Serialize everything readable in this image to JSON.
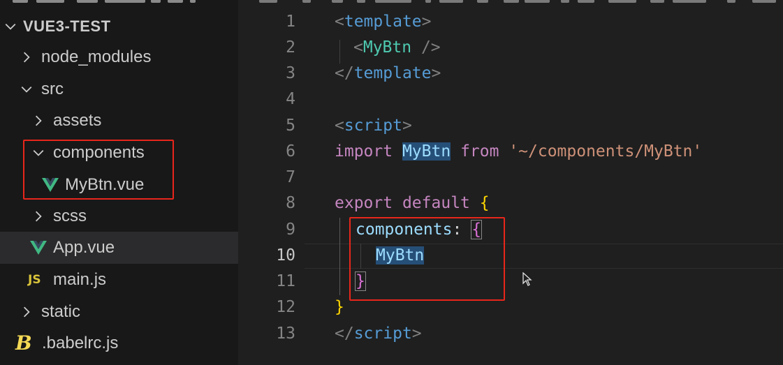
{
  "explorer": {
    "project": "VUE3-TEST",
    "items": [
      {
        "label": "node_modules",
        "kind": "folder",
        "expanded": false
      },
      {
        "label": "src",
        "kind": "folder",
        "expanded": true
      },
      {
        "label": "assets",
        "kind": "folder",
        "expanded": false
      },
      {
        "label": "components",
        "kind": "folder",
        "expanded": true
      },
      {
        "label": "MyBtn.vue",
        "kind": "vue-file"
      },
      {
        "label": "scss",
        "kind": "folder",
        "expanded": false
      },
      {
        "label": "App.vue",
        "kind": "vue-file",
        "selected": true
      },
      {
        "label": "main.js",
        "kind": "js-file",
        "icon_text": "JS"
      },
      {
        "label": "static",
        "kind": "folder",
        "expanded": false
      },
      {
        "label": ".babelrc.js",
        "kind": "babel-file",
        "icon_text": "B"
      }
    ]
  },
  "editor": {
    "active_line": 10,
    "lines": [
      {
        "n": "1",
        "t": [
          "<",
          "template",
          ">"
        ]
      },
      {
        "n": "2",
        "t": [
          "<",
          "MyBtn",
          " />"
        ]
      },
      {
        "n": "3",
        "t": [
          "</",
          "template",
          ">"
        ]
      },
      {
        "n": "4",
        "t": []
      },
      {
        "n": "5",
        "t": [
          "<",
          "script",
          ">"
        ]
      },
      {
        "n": "6",
        "t": [
          "import",
          " ",
          "MyBtn",
          " ",
          "from",
          " ",
          "'~/components/MyBtn'"
        ]
      },
      {
        "n": "7",
        "t": []
      },
      {
        "n": "8",
        "t": [
          "export",
          " ",
          "default",
          " ",
          "{"
        ]
      },
      {
        "n": "9",
        "t": [
          "components",
          ": ",
          "{"
        ]
      },
      {
        "n": "10",
        "t": [
          "MyBtn"
        ]
      },
      {
        "n": "11",
        "t": [
          "}"
        ]
      },
      {
        "n": "12",
        "t": [
          "}"
        ]
      },
      {
        "n": "13",
        "t": [
          "</",
          "script",
          ">"
        ]
      }
    ]
  },
  "colors": {
    "highlight_box": "#e8261b",
    "vue_green": "#41b883",
    "js_yellow": "#d9c33a",
    "babel_yellow": "#f5da55"
  }
}
